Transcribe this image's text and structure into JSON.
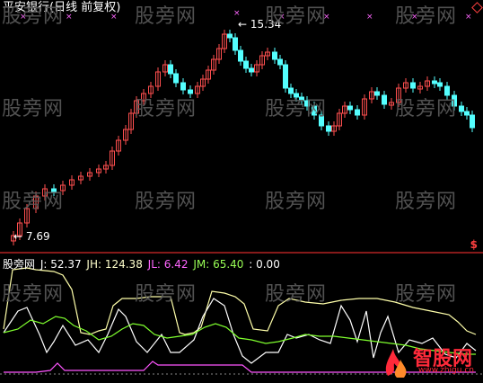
{
  "title": "平安银行(日线 前复权)",
  "price_high_label": "15.34",
  "price_low_label": "7.69",
  "watermark_text": "股旁网",
  "indicator": {
    "name": "股旁网",
    "j_label": "J: 52.37",
    "jh_label": "JH: 124.38",
    "jl_label": "JL: 6.42",
    "jm_label": "JM: 65.40",
    "extra_label": ": 0.00"
  },
  "colors": {
    "up": "#ff4f4f",
    "down": "#54ffff",
    "axis": "#b22222",
    "jl": "#ff55ff",
    "jm": "#7fff2e",
    "j": "#ffffff",
    "jh": "#ffffaa"
  },
  "logo": {
    "text": "智股网",
    "url": "www.zhigu.cn"
  },
  "chart_data": {
    "type": "candlestick",
    "price_range": [
      7.69,
      15.34
    ],
    "indicator_lines": [
      "J",
      "JH",
      "JL",
      "JM"
    ]
  }
}
